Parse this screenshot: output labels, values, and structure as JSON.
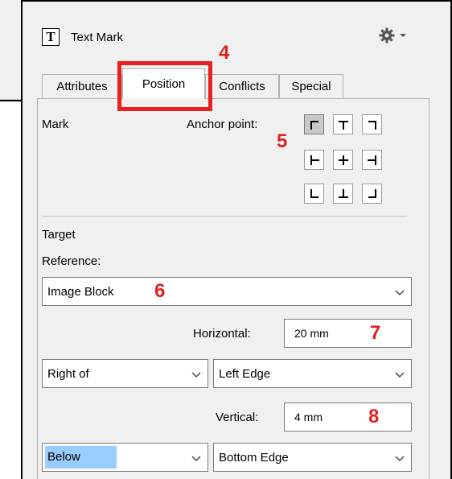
{
  "panel": {
    "title": "Text Mark",
    "title_icon": "text-mark-icon",
    "settings_icon": "gear-icon"
  },
  "tabs": [
    {
      "label": "Attributes",
      "active": false
    },
    {
      "label": "Position",
      "active": true
    },
    {
      "label": "Conflicts",
      "active": false
    },
    {
      "label": "Special",
      "active": false
    }
  ],
  "mark": {
    "section_label": "Mark",
    "anchor_label": "Anchor point:",
    "anchor_points": [
      "top-left",
      "top-center",
      "top-right",
      "middle-left",
      "center",
      "middle-right",
      "bottom-left",
      "bottom-center",
      "bottom-right"
    ],
    "anchor_selected": "top-left"
  },
  "target": {
    "section_label": "Target",
    "reference_label": "Reference:",
    "reference_value": "Image Block",
    "horizontal_label": "Horizontal:",
    "horizontal_value": "20 mm",
    "horizontal_relation": "Right of",
    "horizontal_edge": "Left Edge",
    "vertical_label": "Vertical:",
    "vertical_value": "4 mm",
    "vertical_relation": "Below",
    "vertical_edge": "Bottom Edge"
  },
  "annotations": {
    "n4": "4",
    "n5": "5",
    "n6": "6",
    "n7": "7",
    "n8": "8",
    "color": "#e02020"
  }
}
